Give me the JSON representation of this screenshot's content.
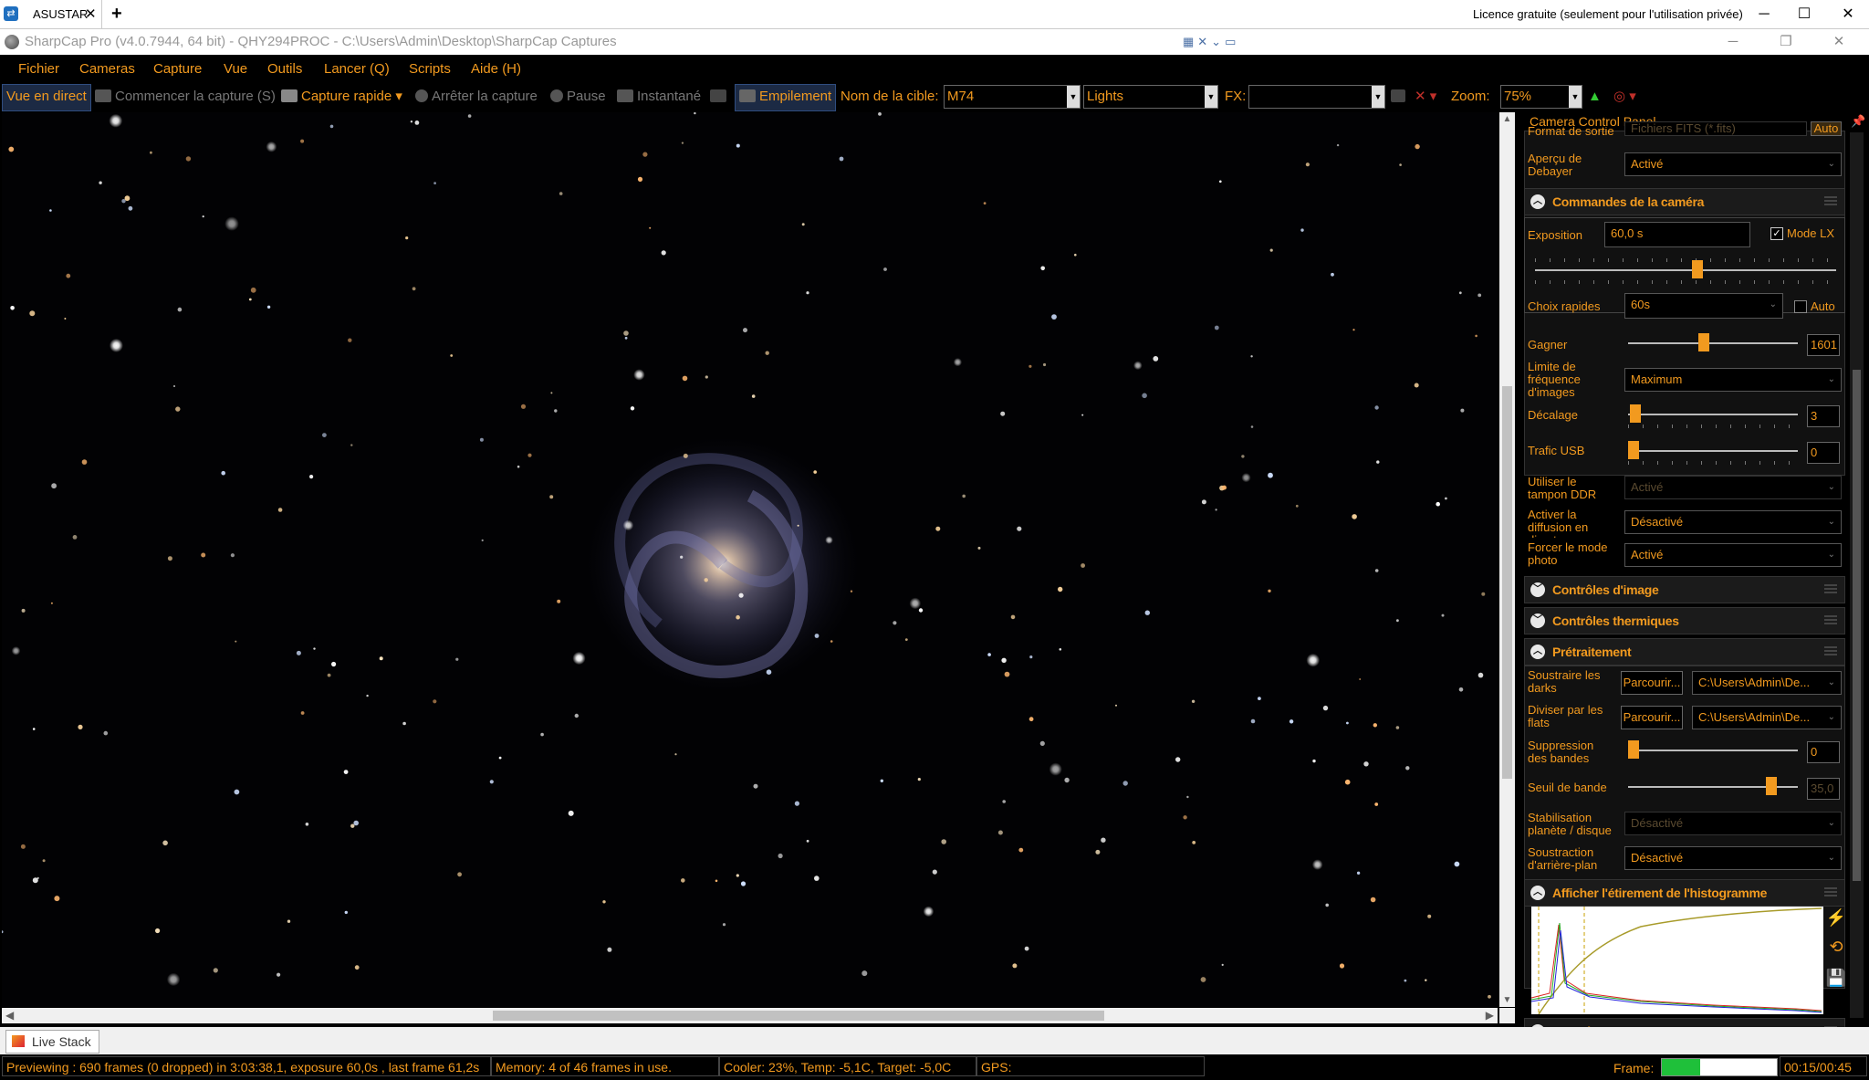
{
  "remote": {
    "tab_label": "ASUSTAR",
    "tab_close": "✕",
    "new_tab": "+",
    "licence": "Licence gratuite (seulement pour l'utilisation privée)",
    "minimize": "─",
    "maximize": "☐",
    "close": "✕"
  },
  "window": {
    "title": "SharpCap Pro (v4.0.7944, 64 bit) - QHY294PROC - C:\\Users\\Admin\\Desktop\\SharpCap Captures",
    "minimize": "─",
    "restore": "❐",
    "close": "✕"
  },
  "menu": [
    "Fichier",
    "Cameras",
    "Capture",
    "Vue",
    "Outils",
    "Lancer (Q)",
    "Scripts",
    "Aide (H)"
  ],
  "toolbar": {
    "live_view": "Vue en direct",
    "start_capture": "Commencer la capture (S)",
    "quick_capture": "Capture rapide",
    "stop_capture": "Arrêter la capture",
    "pause": "Pause",
    "snapshot": "Instantané",
    "stacking": "Empilement",
    "target_label": "Nom de la cible:",
    "target_value": "M74",
    "frame_type": "Lights",
    "fx_label": "FX:",
    "fx_value": "",
    "zoom_label": "Zoom:",
    "zoom_value": "75%"
  },
  "panel": {
    "title": "Camera Control Panel",
    "output_format_label": "Format de sortie",
    "output_format_value": "Fichiers FITS (*.fits)",
    "auto_label": "Auto",
    "debayer_label": "Aperçu de Debayer",
    "debayer_value": "Activé",
    "camera_controls": {
      "title": "Commandes de la caméra",
      "exposure_label": "Exposition",
      "exposure_value": "60,0 s",
      "lx_mode_label": "Mode LX",
      "exposure_fraction": 0.54,
      "quick_choices_label": "Choix rapides",
      "quick_choices_value": "60s",
      "auto_label": "Auto",
      "gain_label": "Gagner",
      "gain_value": "1601",
      "gain_fraction": 0.44,
      "frame_limit_label": "Limite de fréquence d'images",
      "frame_limit_value": "Maximum",
      "offset_label": "Décalage",
      "offset_value": "3",
      "offset_fraction": 0.01,
      "usb_label": "Trafic USB",
      "usb_value": "0",
      "usb_fraction": 0.0,
      "ddr_label": "Utiliser le tampon DDR",
      "ddr_value": "Activé",
      "broadcast_label": "Activer la diffusion en direct",
      "broadcast_value": "Désactivé",
      "photo_label": "Forcer le mode photo",
      "photo_value": "Activé"
    },
    "image_controls_title": "Contrôles d'image",
    "thermal_controls_title": "Contrôles thermiques",
    "preprocessing": {
      "title": "Prétraitement",
      "darks_label": "Soustraire les darks",
      "darks_button": "Parcourir...",
      "darks_path": "C:\\Users\\Admin\\De...",
      "flats_label": "Diviser par les flats",
      "flats_button": "Parcourir...",
      "flats_path": "C:\\Users\\Admin\\De...",
      "banding_label": "Suppression des bandes",
      "banding_value": "0",
      "banding_fraction": 0.0,
      "threshold_label": "Seuil de bande",
      "threshold_value": "35,0",
      "threshold_fraction": 0.87,
      "stabilization_label": "Stabilisation planète / disque",
      "stabilization_value": "Désactivé",
      "background_label": "Soustraction d'arrière-plan",
      "background_value": "Désactivé"
    },
    "histogram_title": "Afficher l'étirement de l'histogramme",
    "telescope_title": "Contrôles du Télescope"
  },
  "bottom_tab": "Live Stack",
  "status": {
    "preview": "Previewing : 690 frames (0 dropped) in 3:03:38,1, exposure 60,0s , last frame 61,2s",
    "memory": "Memory: 4 of 46 frames in use.",
    "cooler": "Cooler: 23%, Temp: -5,1C, Target: -5,0C",
    "gps": "GPS:",
    "frame_label": "Frame:",
    "frame_time": "00:15/00:45",
    "frame_progress": 0.33
  },
  "colors": {
    "accent": "#f29a1f",
    "background": "#000000",
    "live_view_bg": "#1c2a44"
  }
}
